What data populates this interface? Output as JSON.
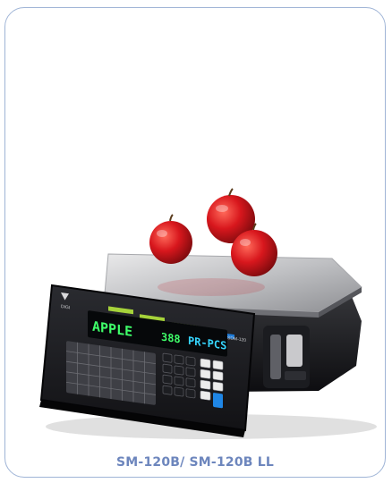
{
  "product": {
    "caption": "SM-120B/ SM-120B LL",
    "display_item": "APPLE",
    "display_price": "388",
    "display_unit": "PR-PCS",
    "brand_mark": "DIGI",
    "model_plate": "SDM-120"
  },
  "colors": {
    "card_border": "#9fb4d6",
    "caption_text": "#6d86bd",
    "lcd_text": "#3fff6a",
    "lcd_unit": "#36d6ff"
  },
  "icons": {
    "scale": "weighing-scale-photo",
    "fruit": "red-apples"
  }
}
